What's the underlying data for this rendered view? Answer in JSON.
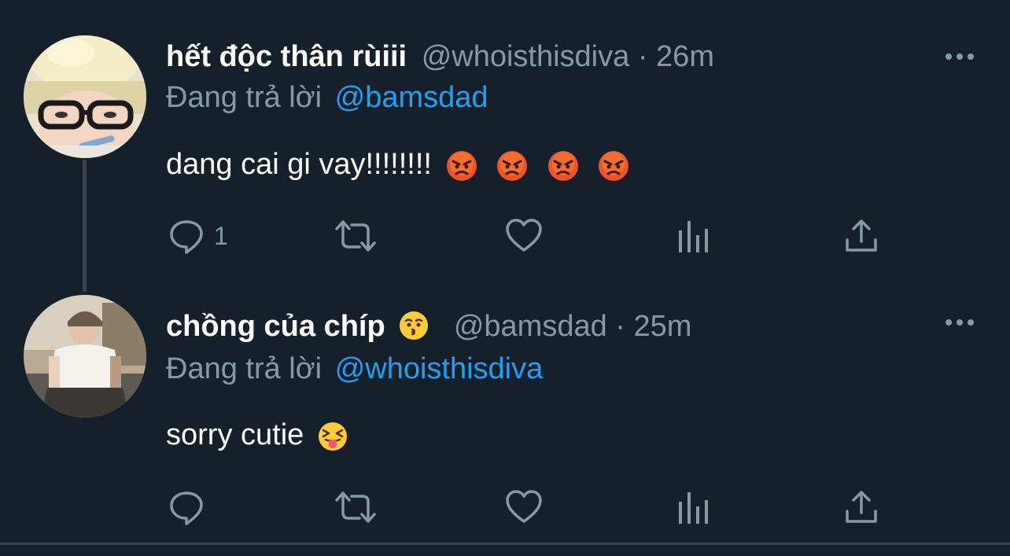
{
  "tweets": [
    {
      "display_name": "hết độc thân rùiii",
      "handle": "@whoisthisdiva",
      "separator": "·",
      "time": "26m",
      "reply_prefix": "Đang trả lời",
      "reply_to": "@bamsdad",
      "text": "dang cai gi vay!!!!!!!!",
      "text_emoji": [
        "angry-face-emoji",
        "angry-face-emoji",
        "angry-face-emoji",
        "angry-face-emoji"
      ],
      "actions": {
        "reply_count": "1",
        "retweet_count": "",
        "like_count": ""
      }
    },
    {
      "display_name": "chồng của chíp",
      "name_emoji": "kissing-face-emoji",
      "handle": "@bamsdad",
      "separator": "·",
      "time": "25m",
      "reply_prefix": "Đang trả lời",
      "reply_to": "@whoisthisdiva",
      "text": "sorry cutie",
      "text_emoji": [
        "squinting-face-with-tongue-emoji"
      ],
      "actions": {
        "reply_count": "",
        "retweet_count": "",
        "like_count": ""
      }
    }
  ],
  "icons": {
    "reply": "reply-icon",
    "retweet": "retweet-icon",
    "like": "heart-icon",
    "analytics": "analytics-icon",
    "share": "share-icon",
    "more": "more-icon"
  },
  "colors": {
    "background": "#15202b",
    "text": "#ffffff",
    "muted": "#8899a6",
    "link": "#1da1f2",
    "border": "#38444d"
  }
}
